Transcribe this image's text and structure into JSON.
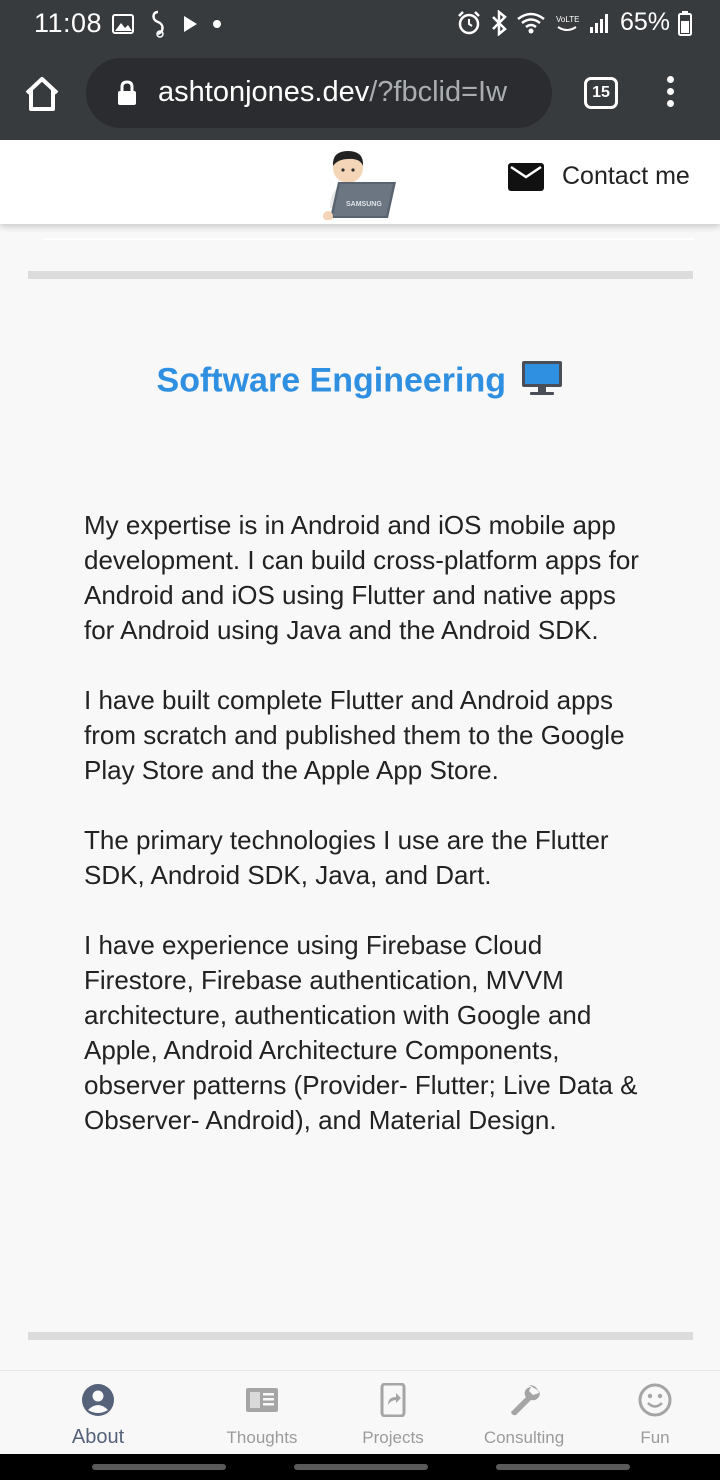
{
  "status_bar": {
    "time": "11:08",
    "battery": "65%",
    "left_icons": [
      "gallery-icon",
      "sim-icon",
      "play-icon",
      "dot-icon"
    ],
    "right_icons": [
      "alarm-icon",
      "bluetooth-icon",
      "wifi-icon",
      "volte-icon",
      "signal-icon",
      "battery-icon"
    ]
  },
  "browser": {
    "url_domain": "ashtonjones.dev",
    "url_rest": "/?fbclid=Iw",
    "tab_count": "15"
  },
  "site_header": {
    "logo_text": "SAMSUNG",
    "contact_label": "Contact me"
  },
  "section": {
    "title": "Software Engineering",
    "paragraphs": [
      "My expertise is in Android and iOS mobile app development. I can build cross-platform apps for Android and iOS using Flutter and native apps for Android using Java and the Android SDK.",
      "I have built complete Flutter and Android apps from scratch and published them to the Google Play Store and the Apple App Store.",
      "The primary technologies I use are the Flutter SDK, Android SDK, Java, and Dart.",
      "I have experience using Firebase Cloud Firestore, Firebase authentication, MVVM architecture, authentication with Google and Apple, Android Architecture Components, observer patterns (Provider- Flutter; Live Data & Observer- Android), and Material Design."
    ]
  },
  "bottom_nav": {
    "items": [
      {
        "label": "About",
        "icon": "account-circle-icon",
        "active": true
      },
      {
        "label": "Thoughts",
        "icon": "article-icon",
        "active": false
      },
      {
        "label": "Projects",
        "icon": "phone-share-icon",
        "active": false
      },
      {
        "label": "Consulting",
        "icon": "wrench-icon",
        "active": false
      },
      {
        "label": "Fun",
        "icon": "smiley-icon",
        "active": false
      }
    ]
  },
  "colors": {
    "chrome": "#383b3e",
    "title_blue": "#2f8fe0",
    "nav_active": "#55627a",
    "nav_inactive": "#9b9b9b"
  }
}
